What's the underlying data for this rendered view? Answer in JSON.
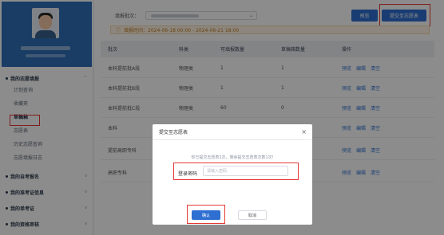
{
  "sidebar": {
    "groups": [
      {
        "label": "我的志愿填报",
        "chevron": "^"
      },
      {
        "label": "我的自考报名",
        "chevron": "v"
      },
      {
        "label": "我的准考证信息",
        "chevron": "v"
      },
      {
        "label": "我的单考证",
        "chevron": "v"
      },
      {
        "label": "我的资格审核",
        "chevron": "v"
      }
    ],
    "items": [
      "计划查询",
      "收藏夹",
      "草稿箱",
      "志愿表",
      "历史志愿查询",
      "志愿填报日志"
    ]
  },
  "filter": {
    "label": "填报批次："
  },
  "buttons": {
    "preview": "预览",
    "submit": "提交至志愿表"
  },
  "notice": {
    "text": "填报时间：2024-06-18 00:00 - 2024-06-21 18:00"
  },
  "table": {
    "headers": [
      "批次",
      "科类",
      "可填报数量",
      "草稿箱数量",
      "操作"
    ],
    "rows": [
      {
        "batch": "本科提前批A段",
        "category": "物理类",
        "available": "1",
        "draft": "1",
        "ops": [
          "预览",
          "编辑",
          "清空"
        ]
      },
      {
        "batch": "本科提前批B段",
        "category": "物理类",
        "available": "1",
        "draft": "1",
        "ops": [
          "预览",
          "编辑",
          "清空"
        ]
      },
      {
        "batch": "本科提前批C段",
        "category": "物理类",
        "available": "60",
        "draft": "0",
        "ops": [
          "预览",
          "编辑",
          "清空"
        ]
      },
      {
        "batch": "本科",
        "category": "",
        "available": "",
        "draft": "",
        "ops": [
          "预览",
          "编辑",
          "清空"
        ]
      },
      {
        "batch": "提前高职专科",
        "category": "",
        "available": "",
        "draft": "",
        "ops": [
          "预览",
          "编辑",
          "清空"
        ]
      },
      {
        "batch": "高职专科",
        "category": "",
        "available": "",
        "draft": "",
        "ops": [
          "预览",
          "编辑",
          "清空"
        ]
      }
    ]
  },
  "modal": {
    "title": "提交至志愿表",
    "close": "×",
    "tip": "你已提交志愿表2次，剩余提交志愿表次数1次!",
    "field_label": "登录密码",
    "field_placeholder": "请输入密码",
    "ok": "确认",
    "cancel": "取消"
  }
}
